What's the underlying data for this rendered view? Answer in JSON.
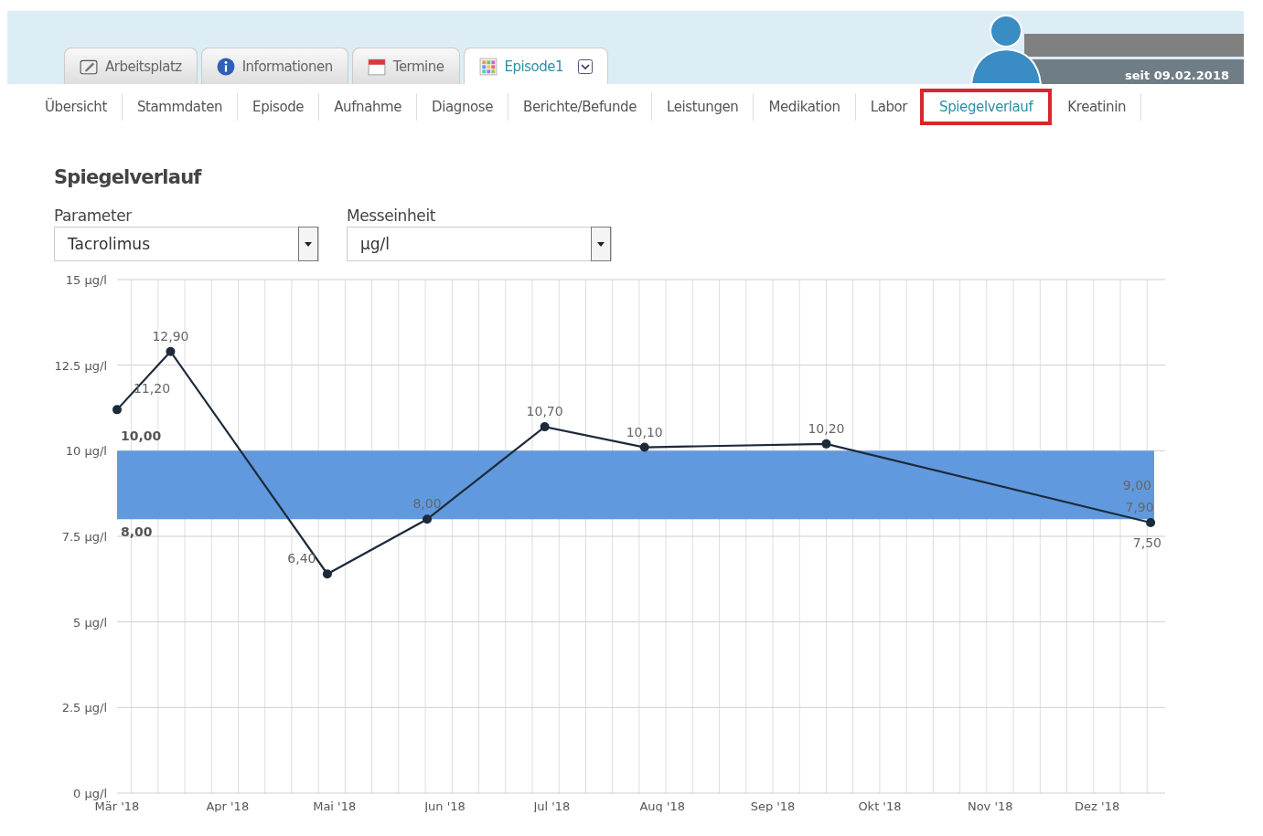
{
  "top_tabs": [
    {
      "label": "Arbeitsplatz",
      "selected": false
    },
    {
      "label": "Informationen",
      "selected": false
    },
    {
      "label": "Termine",
      "selected": false
    },
    {
      "label": "Episode1",
      "selected": true,
      "menu": true
    }
  ],
  "patient": {
    "since": "seit 09.02.2018"
  },
  "nav": [
    {
      "label": "Übersicht",
      "selected": false
    },
    {
      "label": "Stammdaten",
      "selected": false
    },
    {
      "label": "Episode",
      "selected": false
    },
    {
      "label": "Aufnahme",
      "selected": false
    },
    {
      "label": "Diagnose",
      "selected": false
    },
    {
      "label": "Berichte/Befunde",
      "selected": false
    },
    {
      "label": "Leistungen",
      "selected": false
    },
    {
      "label": "Medikation",
      "selected": false
    },
    {
      "label": "Labor",
      "selected": false
    },
    {
      "label": "Spiegelverlauf",
      "selected": true
    },
    {
      "label": "Kreatinin",
      "selected": false
    }
  ],
  "title": "Spiegelverlauf",
  "fields": [
    {
      "label": "Parameter",
      "value": "Tacrolimus"
    },
    {
      "label": "Messeinheit",
      "value": "µg/l"
    }
  ],
  "chart_data": {
    "type": "line",
    "x": [
      "2018-03-01",
      "2018-03-16",
      "2018-04-29",
      "2018-05-27",
      "2018-06-29",
      "2018-07-27",
      "2018-09-16",
      "2018-12-16"
    ],
    "series": [
      {
        "color": "#1c2a3a",
        "marker": "circle",
        "values": [
          11.2,
          12.9,
          6.4,
          8.0,
          10.7,
          10.1,
          10.2,
          7.9
        ],
        "value_labels": [
          "11,20",
          "12,90",
          "6,40",
          "8,00",
          "10,70",
          "10,10",
          "10,20",
          "7,90"
        ]
      }
    ],
    "xlim": [
      "2018-03-01",
      "2018-12-17"
    ],
    "ylim": [
      0,
      15
    ],
    "xticks": [
      {
        "value": "2018-03-01",
        "label": "Mär '18"
      },
      {
        "value": "2018-04-01",
        "label": "Apr '18"
      },
      {
        "value": "2018-05-01",
        "label": "Mai '18"
      },
      {
        "value": "2018-06-01",
        "label": "Jun '18"
      },
      {
        "value": "2018-07-01",
        "label": "Jul '18"
      },
      {
        "value": "2018-08-01",
        "label": "Aug '18"
      },
      {
        "value": "2018-09-01",
        "label": "Sep '18"
      },
      {
        "value": "2018-10-01",
        "label": "Okt '18"
      },
      {
        "value": "2018-11-01",
        "label": "Nov '18"
      },
      {
        "value": "2018-12-01",
        "label": "Dez '18"
      }
    ],
    "yticks": [
      {
        "value": 0,
        "label": "0 µg/l"
      },
      {
        "value": 2.5,
        "label": "2.5 µg/l"
      },
      {
        "value": 5,
        "label": "5 µg/l"
      },
      {
        "value": 7.5,
        "label": "7.5 µg/l"
      },
      {
        "value": 10,
        "label": "10 µg/l"
      },
      {
        "value": 12.5,
        "label": "12.5 µg/l"
      },
      {
        "value": 15,
        "label": "15 µg/l"
      }
    ],
    "data_labels": true,
    "grid": true,
    "bands": [
      {
        "axis": "y",
        "from": 8,
        "to": 10,
        "color": "#6199de"
      }
    ],
    "annotations": [
      "10,00",
      "8,00",
      "9,00",
      "7,50"
    ]
  }
}
